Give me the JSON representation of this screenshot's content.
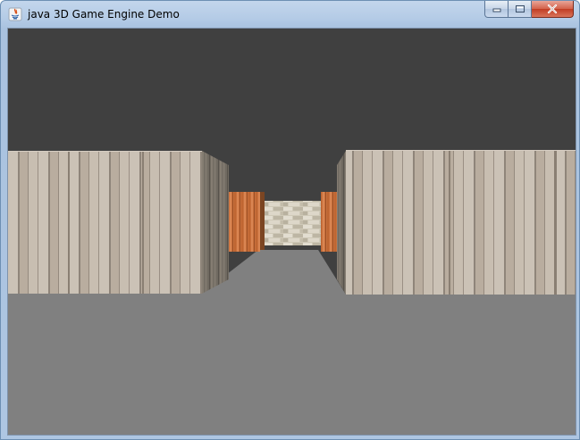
{
  "window": {
    "title": "java 3D Game Engine Demo",
    "app_icon": "java-icon",
    "controls": [
      {
        "name": "minimize-button",
        "icon": "minimize-icon"
      },
      {
        "name": "maximize-button",
        "icon": "maximize-icon"
      },
      {
        "name": "close-button",
        "icon": "close-icon"
      }
    ]
  },
  "scene": {
    "ceiling_color": "#404040",
    "floor_color": "#808080",
    "wall_texture": "light-wood-planks",
    "side_wall_texture": "dark-wood-planks",
    "door_texture": "orange-wood-planks",
    "end_wall_texture": "stone-brick"
  }
}
